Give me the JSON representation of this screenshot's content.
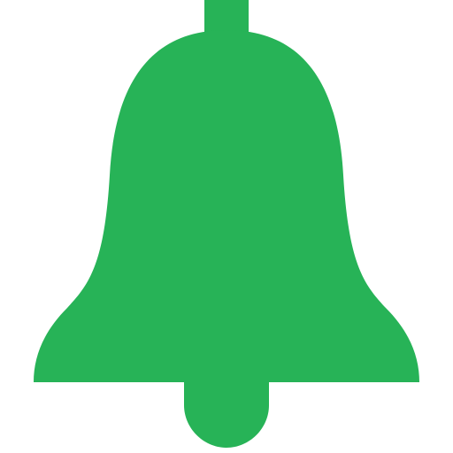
{
  "icon": {
    "name": "bell-icon",
    "color": "#27B357",
    "background": "#FFFFFF"
  }
}
